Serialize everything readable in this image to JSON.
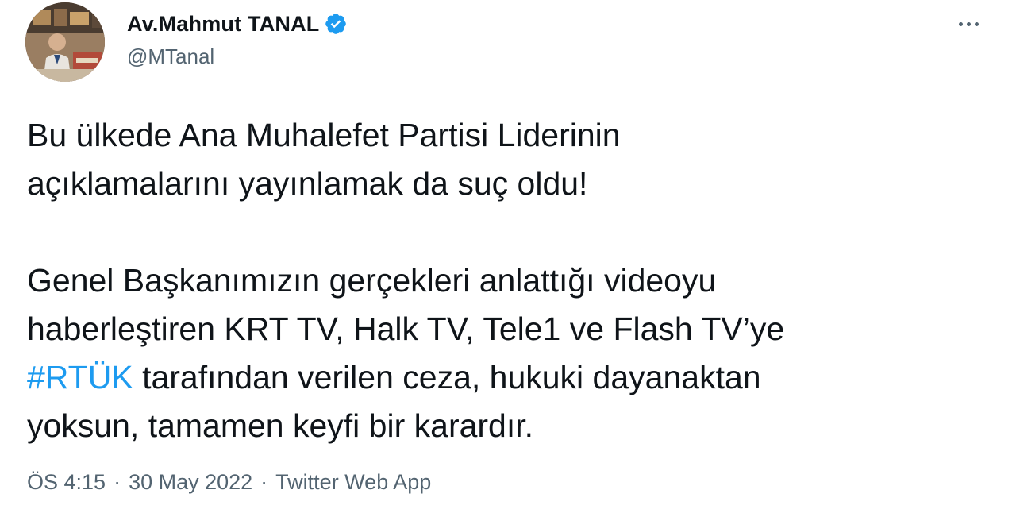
{
  "author": {
    "display_name": "Av.Mahmut TANAL",
    "handle": "@MTanal",
    "verified": true
  },
  "tweet": {
    "line1": "Bu ülkede Ana Muhalefet Partisi Liderinin",
    "line2": "açıklamalarını yayınlamak da suç oldu!",
    "line3": "Genel Başkanımızın gerçekleri anlattığı videoyu",
    "line4": "haberleştiren KRT TV, Halk TV, Tele1 ve Flash TV’ye",
    "hashtag": "#RTÜK",
    "line5_rest": " tarafından verilen ceza, hukuki dayanaktan",
    "line6": "yoksun, tamamen keyfi bir karardır."
  },
  "meta": {
    "time": "ÖS 4:15",
    "separator": "·",
    "date": "30 May 2022",
    "source": "Twitter Web App"
  },
  "colors": {
    "accent": "#1d9bf0",
    "text": "#0f1419",
    "secondary": "#536471"
  },
  "icons": {
    "verified": "verified-badge-icon",
    "more": "more-options-icon"
  }
}
